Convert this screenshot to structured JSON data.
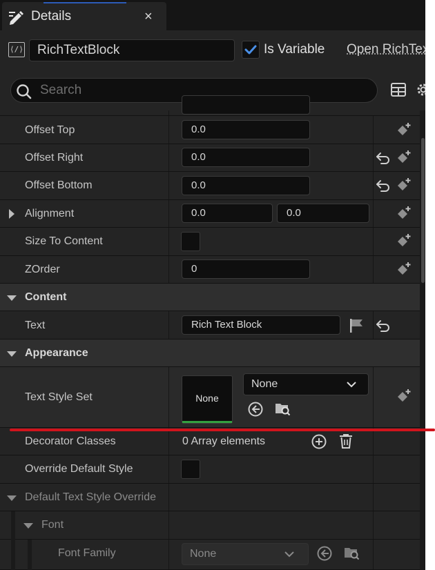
{
  "tab": {
    "title": "Details",
    "close": "×"
  },
  "header": {
    "widget_name": "RichTextBlock",
    "is_variable_label": "Is Variable",
    "is_variable_checked": true,
    "open_link": "Open RichTex"
  },
  "search": {
    "placeholder": "Search"
  },
  "rows": {
    "offset_top": {
      "label": "Offset Top",
      "value": "0.0"
    },
    "offset_right": {
      "label": "Offset Right",
      "value": "0.0"
    },
    "offset_bottom": {
      "label": "Offset Bottom",
      "value": "0.0"
    },
    "alignment": {
      "label": "Alignment",
      "x": "0.0",
      "y": "0.0"
    },
    "size_to_content": {
      "label": "Size To Content",
      "checked": false
    },
    "zorder": {
      "label": "ZOrder",
      "value": "0"
    },
    "content_category": {
      "label": "Content"
    },
    "text": {
      "label": "Text",
      "value": "Rich Text Block"
    },
    "appearance_category": {
      "label": "Appearance"
    },
    "text_style_set": {
      "label": "Text Style Set",
      "thumb_label": "None",
      "combo_value": "None"
    },
    "decorator_classes": {
      "label": "Decorator Classes",
      "value": "0 Array elements"
    },
    "override_default_style": {
      "label": "Override Default Style",
      "checked": false
    },
    "default_text_style_override": {
      "label": "Default Text Style Override"
    },
    "font": {
      "label": "Font"
    },
    "font_family": {
      "label": "Font Family",
      "value": "None"
    }
  },
  "colors": {
    "panel_bg": "#242424",
    "category_bg": "#2f2f2f",
    "accent_blue": "#2d5bb8",
    "checkbox_check": "#4a90e8",
    "thumb_green": "#34a040",
    "annotation_red": "#d0141c"
  }
}
